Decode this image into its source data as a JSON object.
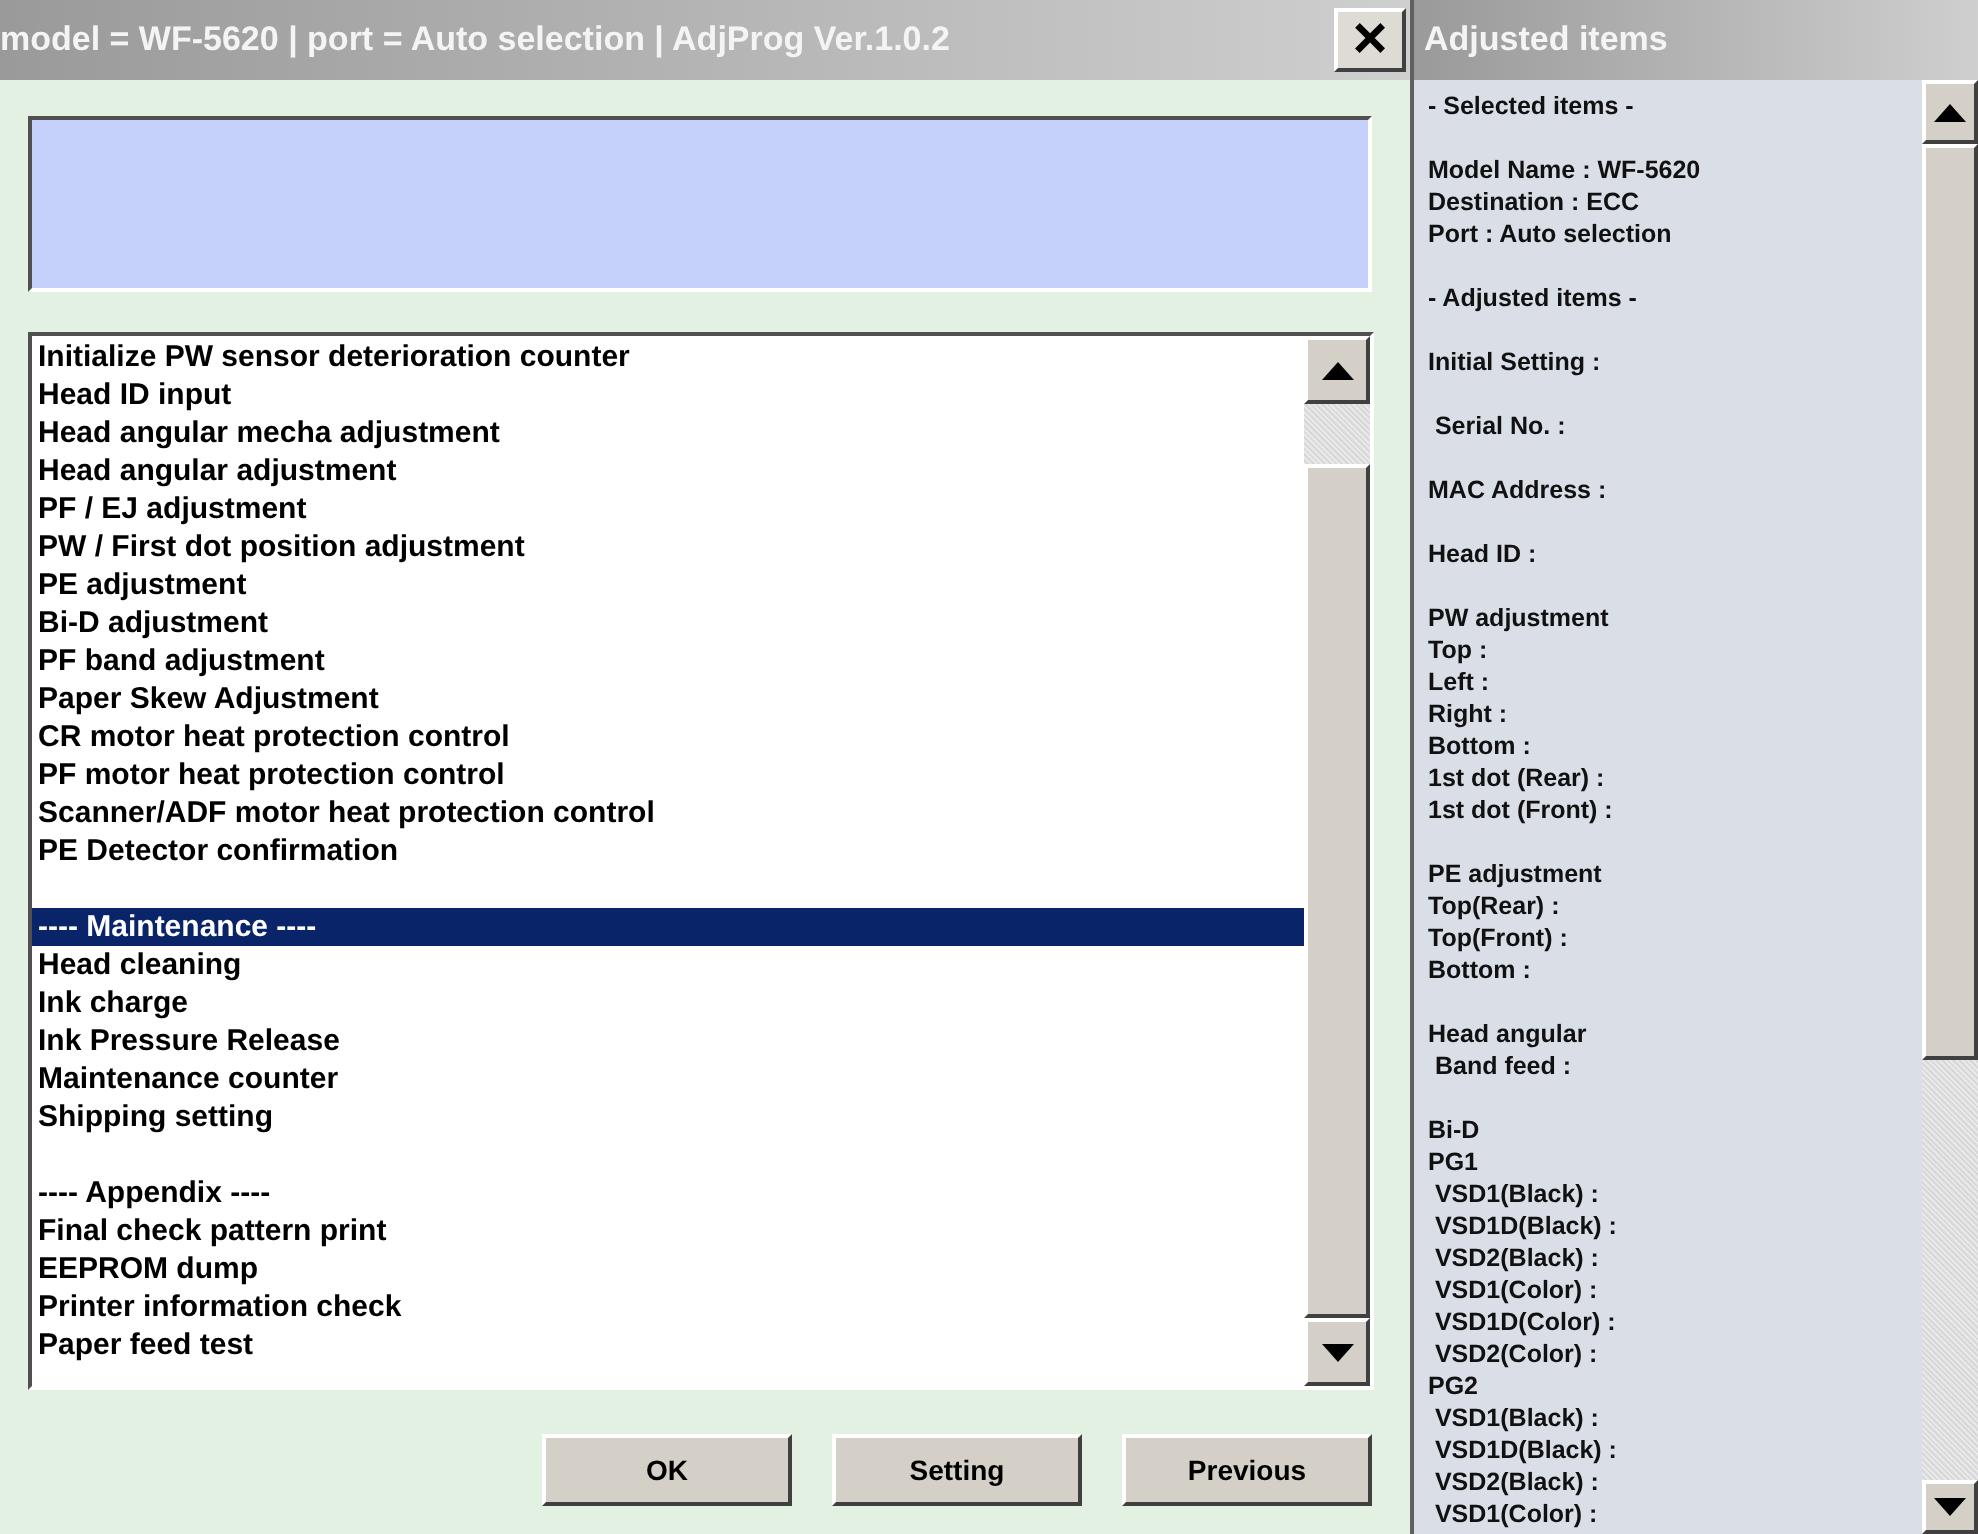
{
  "window": {
    "title": "model = WF-5620 | port = Auto selection | AdjProg Ver.1.0.2",
    "close": "×"
  },
  "menu_list": [
    {
      "kind": "entry",
      "label": "Initialize PW sensor deterioration counter",
      "selected": false
    },
    {
      "kind": "entry",
      "label": "Head ID input",
      "selected": false
    },
    {
      "kind": "entry",
      "label": "Head angular mecha adjustment",
      "selected": false
    },
    {
      "kind": "entry",
      "label": "Head angular adjustment",
      "selected": false
    },
    {
      "kind": "entry",
      "label": "PF / EJ adjustment",
      "selected": false
    },
    {
      "kind": "entry",
      "label": "PW / First dot position adjustment",
      "selected": false
    },
    {
      "kind": "entry",
      "label": "PE adjustment",
      "selected": false
    },
    {
      "kind": "entry",
      "label": "Bi-D adjustment",
      "selected": false
    },
    {
      "kind": "entry",
      "label": "PF band adjustment",
      "selected": false
    },
    {
      "kind": "entry",
      "label": "Paper Skew Adjustment",
      "selected": false
    },
    {
      "kind": "entry",
      "label": "CR motor heat protection control",
      "selected": false
    },
    {
      "kind": "entry",
      "label": "PF motor heat protection control",
      "selected": false
    },
    {
      "kind": "entry",
      "label": "Scanner/ADF motor heat protection control",
      "selected": false
    },
    {
      "kind": "entry",
      "label": "PE Detector confirmation",
      "selected": false
    },
    {
      "kind": "spacer"
    },
    {
      "kind": "entry",
      "label": "---- Maintenance ----",
      "selected": true
    },
    {
      "kind": "entry",
      "label": "Head cleaning",
      "selected": false
    },
    {
      "kind": "entry",
      "label": "Ink charge",
      "selected": false
    },
    {
      "kind": "entry",
      "label": "Ink Pressure Release",
      "selected": false
    },
    {
      "kind": "entry",
      "label": "Maintenance counter",
      "selected": false
    },
    {
      "kind": "entry",
      "label": "Shipping setting",
      "selected": false
    },
    {
      "kind": "spacer"
    },
    {
      "kind": "entry",
      "label": "---- Appendix ----",
      "selected": false
    },
    {
      "kind": "entry",
      "label": "Final check pattern print",
      "selected": false
    },
    {
      "kind": "entry",
      "label": "EEPROM dump",
      "selected": false
    },
    {
      "kind": "entry",
      "label": "Printer information check",
      "selected": false
    },
    {
      "kind": "entry",
      "label": "Paper feed test",
      "selected": false
    }
  ],
  "buttons": [
    "OK",
    "Setting",
    "Previous"
  ],
  "side_panel": {
    "title": "Adjusted items",
    "lines": [
      {
        "kind": "text",
        "text": "- Selected items -"
      },
      {
        "kind": "spacer"
      },
      {
        "kind": "text",
        "text": "Model Name : WF-5620"
      },
      {
        "kind": "text",
        "text": "Destination : ECC"
      },
      {
        "kind": "text",
        "text": "Port : Auto selection"
      },
      {
        "kind": "spacer"
      },
      {
        "kind": "text",
        "text": "- Adjusted items -"
      },
      {
        "kind": "spacer"
      },
      {
        "kind": "text",
        "text": "Initial Setting :"
      },
      {
        "kind": "spacer"
      },
      {
        "kind": "text",
        "text": " Serial No. :"
      },
      {
        "kind": "spacer"
      },
      {
        "kind": "text",
        "text": "MAC Address :"
      },
      {
        "kind": "spacer"
      },
      {
        "kind": "text",
        "text": "Head ID :"
      },
      {
        "kind": "spacer"
      },
      {
        "kind": "text",
        "text": "PW adjustment"
      },
      {
        "kind": "text",
        "text": "Top :"
      },
      {
        "kind": "text",
        "text": "Left :"
      },
      {
        "kind": "text",
        "text": "Right :"
      },
      {
        "kind": "text",
        "text": "Bottom :"
      },
      {
        "kind": "text",
        "text": "1st dot (Rear) :"
      },
      {
        "kind": "text",
        "text": "1st dot (Front) :"
      },
      {
        "kind": "spacer"
      },
      {
        "kind": "text",
        "text": "PE adjustment"
      },
      {
        "kind": "text",
        "text": "Top(Rear) :"
      },
      {
        "kind": "text",
        "text": "Top(Front) :"
      },
      {
        "kind": "text",
        "text": "Bottom :"
      },
      {
        "kind": "spacer"
      },
      {
        "kind": "text",
        "text": "Head angular"
      },
      {
        "kind": "text",
        "text": " Band feed :"
      },
      {
        "kind": "spacer"
      },
      {
        "kind": "text",
        "text": "Bi-D"
      },
      {
        "kind": "text",
        "text": "PG1"
      },
      {
        "kind": "text",
        "text": " VSD1(Black) :"
      },
      {
        "kind": "text",
        "text": " VSD1D(Black) :"
      },
      {
        "kind": "text",
        "text": " VSD2(Black) :"
      },
      {
        "kind": "text",
        "text": " VSD1(Color) :"
      },
      {
        "kind": "text",
        "text": " VSD1D(Color) :"
      },
      {
        "kind": "text",
        "text": " VSD2(Color) :"
      },
      {
        "kind": "text",
        "text": "PG2"
      },
      {
        "kind": "text",
        "text": " VSD1(Black) :"
      },
      {
        "kind": "text",
        "text": " VSD1D(Black) :"
      },
      {
        "kind": "text",
        "text": " VSD2(Black) :"
      },
      {
        "kind": "text",
        "text": " VSD1(Color) :"
      }
    ]
  }
}
